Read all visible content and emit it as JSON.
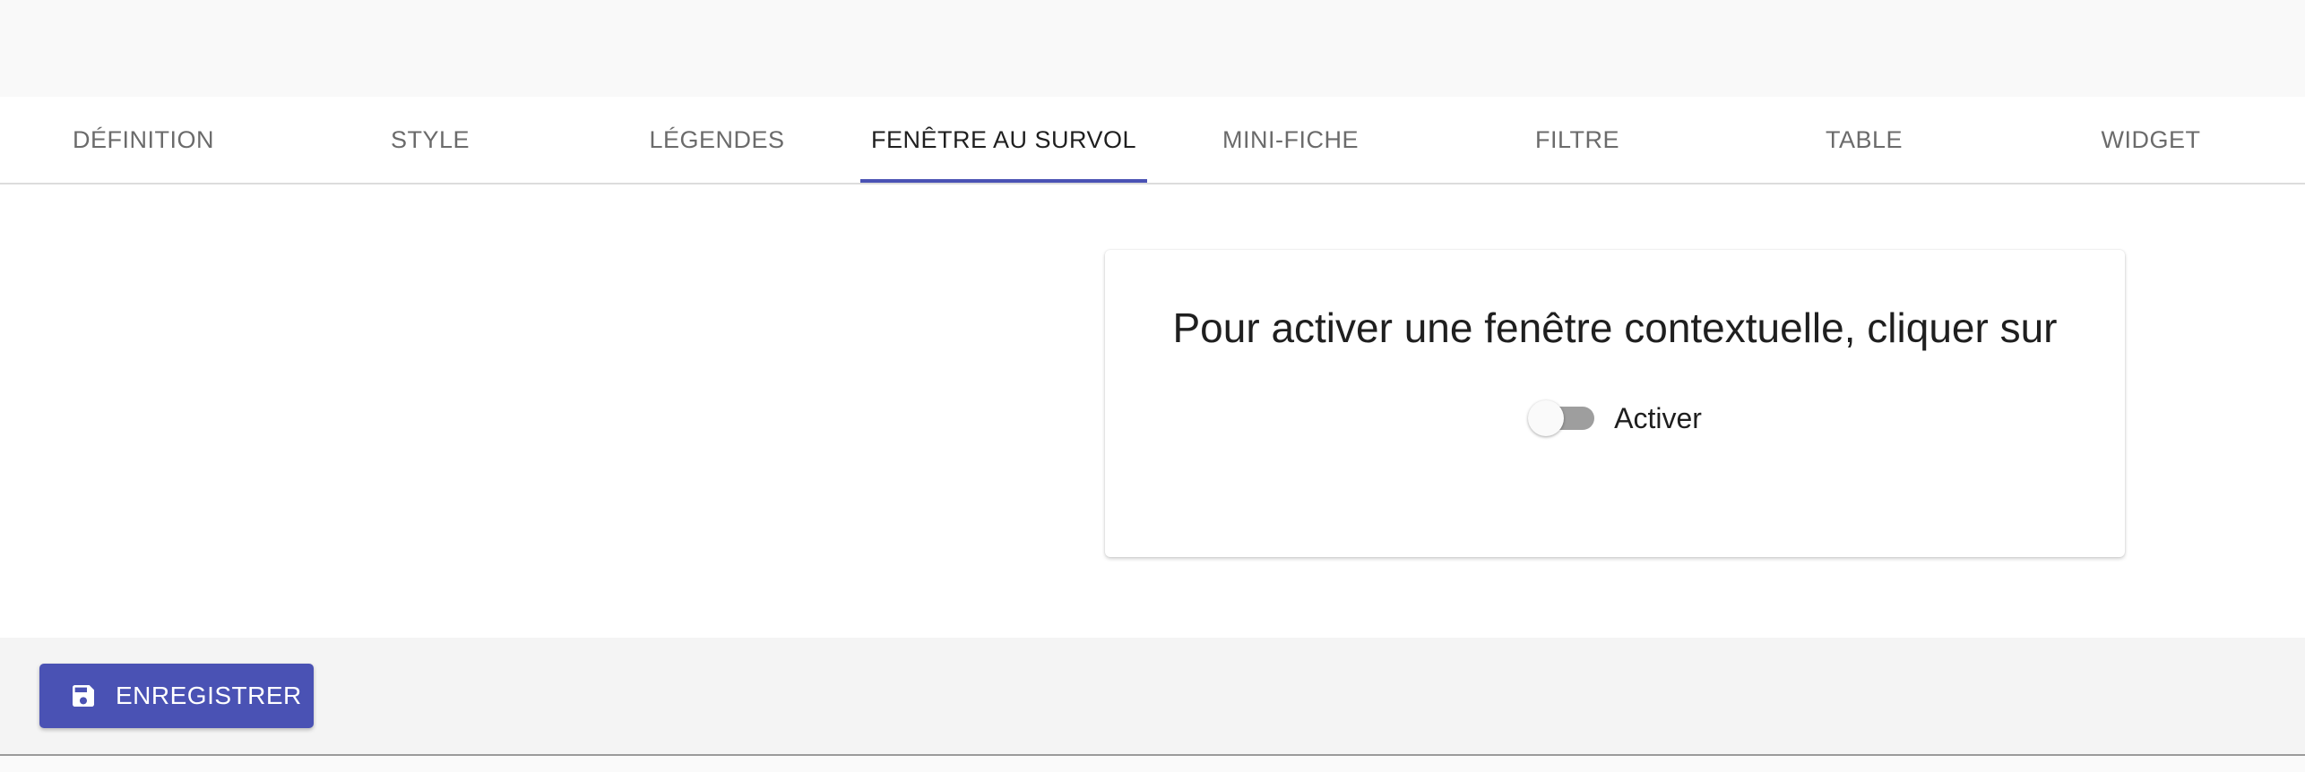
{
  "tabs": [
    {
      "label": "DÉFINITION"
    },
    {
      "label": "STYLE"
    },
    {
      "label": "LÉGENDES"
    },
    {
      "label": "FENÊTRE AU SURVOL"
    },
    {
      "label": "MINI-FICHE"
    },
    {
      "label": "FILTRE"
    },
    {
      "label": "TABLE"
    },
    {
      "label": "WIDGET"
    }
  ],
  "active_tab": "FENÊTRE AU SURVOL",
  "card": {
    "title": "Pour activer une fenêtre contextuelle, cliquer sur",
    "toggle": {
      "label": "Activer",
      "checked": false
    }
  },
  "footer": {
    "save_label": "ENREGISTRER",
    "save_icon": "floppy-disk-icon"
  },
  "colors": {
    "accent": "#4a52b4",
    "toggle_off_track": "#9e9e9e"
  }
}
